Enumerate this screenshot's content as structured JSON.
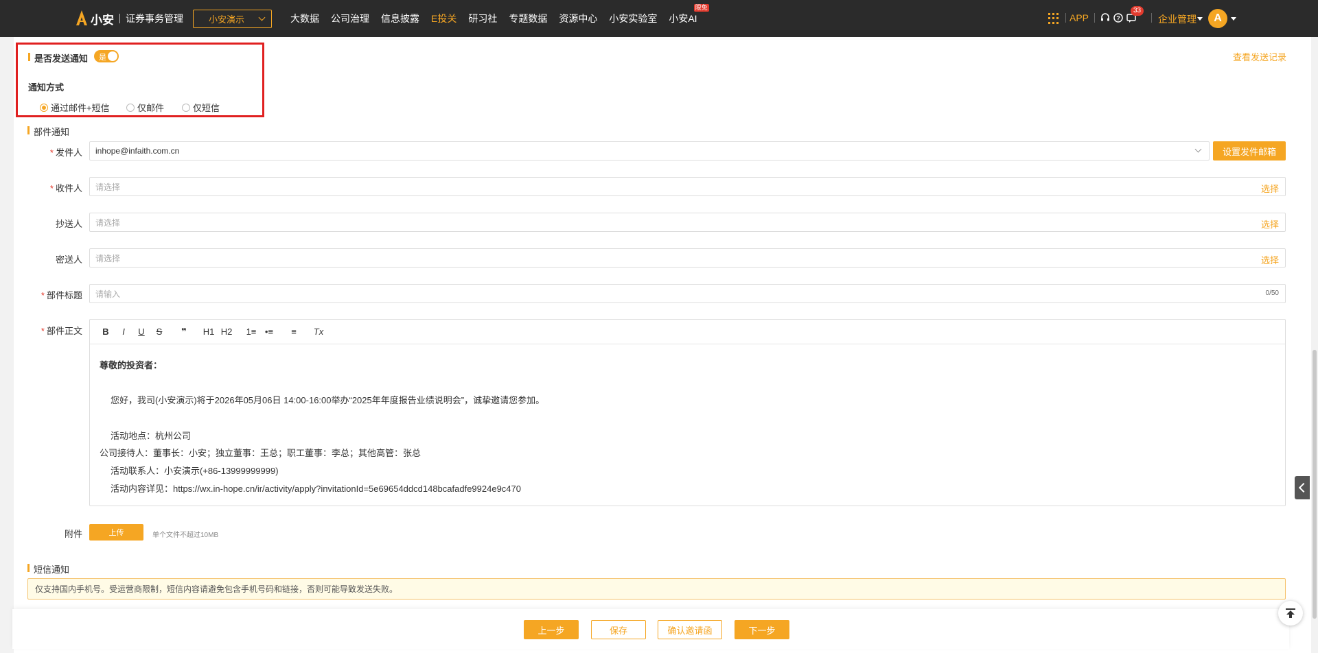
{
  "header": {
    "logo_text": "小安",
    "logo_sub": "证券事务管理",
    "company_select": "小安演示",
    "nav": [
      {
        "label": "大数据",
        "active": false
      },
      {
        "label": "公司治理",
        "active": false
      },
      {
        "label": "信息披露",
        "active": false
      },
      {
        "label": "E投关",
        "active": true
      },
      {
        "label": "研习社",
        "active": false
      },
      {
        "label": "专题数据",
        "active": false
      },
      {
        "label": "资源中心",
        "active": false
      },
      {
        "label": "小安实验室",
        "active": false
      },
      {
        "label": "小安AI",
        "active": false,
        "badge": "限免"
      }
    ],
    "app_label": "APP",
    "message_count": "33",
    "enterprise_mgmt": "企业管理",
    "avatar_letter": "A"
  },
  "notify": {
    "send_label": "是否发送通知",
    "toggle_text": "是",
    "toggle_on": true,
    "view_log": "查看发送记录",
    "method_label": "通知方式",
    "methods": [
      {
        "label": "通过邮件+短信",
        "checked": true
      },
      {
        "label": "仅邮件",
        "checked": false
      },
      {
        "label": "仅短信",
        "checked": false
      }
    ]
  },
  "email": {
    "section_title": "部件通知",
    "sender_label": "发件人",
    "sender_value": "inhope@infaith.com.cn",
    "set_sender_button": "设置发件邮箱",
    "recipient_label": "收件人",
    "recipient_placeholder": "请选择",
    "cc_label": "抄送人",
    "cc_placeholder": "请选择",
    "bcc_label": "密送人",
    "bcc_placeholder": "请选择",
    "select_link": "选择",
    "subject_label": "部件标题",
    "subject_placeholder": "请输入",
    "subject_counter": "0/50",
    "body_label": "部件正文",
    "toolbar": [
      "B",
      "I",
      "U",
      "S",
      "❞",
      "H1",
      "H2",
      "1≡",
      "•≡",
      "≡",
      "Tx"
    ],
    "body": {
      "greeting": "尊敬的投资者：",
      "invite": "您好，我司(小安演示)将于2026年05月06日 14:00-16:00举办“2025年年度报告业绩说明会”，诚挚邀请您参加。",
      "location": "活动地点：杭州公司",
      "hosts": "公司接待人：董事长：小安；独立董事：王总；职工董事：李总；其他高管：张总",
      "contact": "活动联系人：小安演示(+86-13999999999)",
      "details": "活动内容详见：https://wx.in-hope.cn/ir/activity/apply?invitationId=5e69654ddcd148bcafadfe9924e9c470"
    },
    "attachment_label": "附件",
    "upload_button": "上传",
    "upload_hint": "单个文件不超过10MB"
  },
  "sms": {
    "section_title": "短信通知",
    "warning": "仅支持国内手机号。受运营商限制，短信内容请避免包含手机号码和链接，否则可能导致发送失败。"
  },
  "footer": {
    "prev_button": "上一步",
    "save_button": "保存",
    "confirm_button": "确认邀请函",
    "next_button": "下一步"
  },
  "colors": {
    "accent": "#f5a623",
    "topbar": "#2b2b2b",
    "highlight_border": "#e02020"
  }
}
